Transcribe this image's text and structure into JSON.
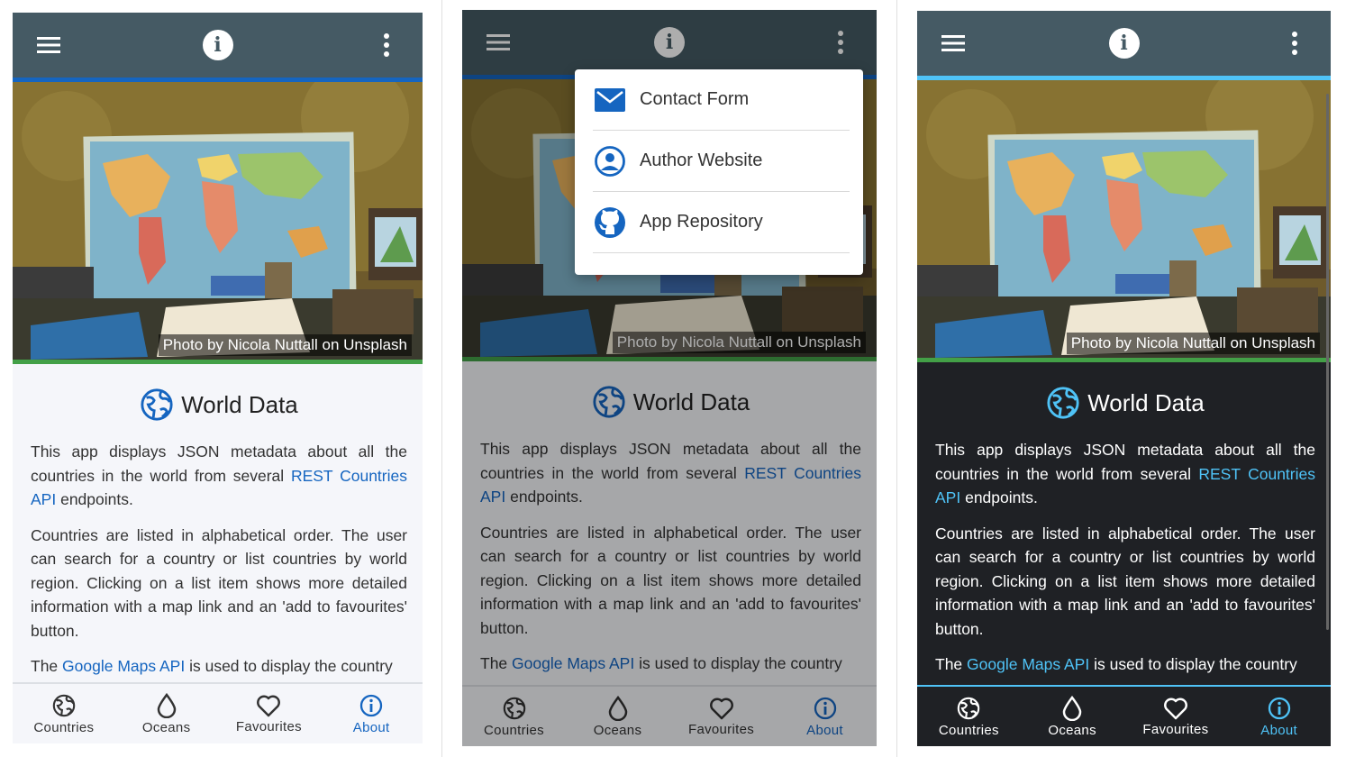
{
  "app": {
    "title": "World Data",
    "photo_credit": "Photo by Nicola Nuttall on Unsplash"
  },
  "content": {
    "p1_pre": "This app displays JSON metadata about all the countries in the world from several ",
    "p1_link": "REST Countries API",
    "p1_post": " endpoints.",
    "p2": "Countries are listed in alphabetical order. The user can search for a country or list countries by world region. Clicking on a list item shows more detailed information with a map link and an 'add to favourites' button.",
    "p3_pre": "The ",
    "p3_link": "Google Maps API",
    "p3_post": " is used to display the country"
  },
  "menu": {
    "items": [
      {
        "label": "Contact Form",
        "icon": "envelope-icon"
      },
      {
        "label": "Author Website",
        "icon": "account-circle-icon"
      },
      {
        "label": "App Repository",
        "icon": "github-icon"
      }
    ]
  },
  "nav": {
    "items": [
      {
        "label": "Countries",
        "icon": "globe-icon"
      },
      {
        "label": "Oceans",
        "icon": "water-drop-icon"
      },
      {
        "label": "Favourites",
        "icon": "heart-icon"
      },
      {
        "label": "About",
        "icon": "info-icon",
        "active": true
      }
    ]
  },
  "colors": {
    "appbar": "#455a64",
    "accent_light": "#1565c0",
    "accent_dark": "#4fc3f7",
    "divider_green": "#43a047",
    "bg_light": "#f5f6fa",
    "bg_dark": "#1f2125"
  }
}
